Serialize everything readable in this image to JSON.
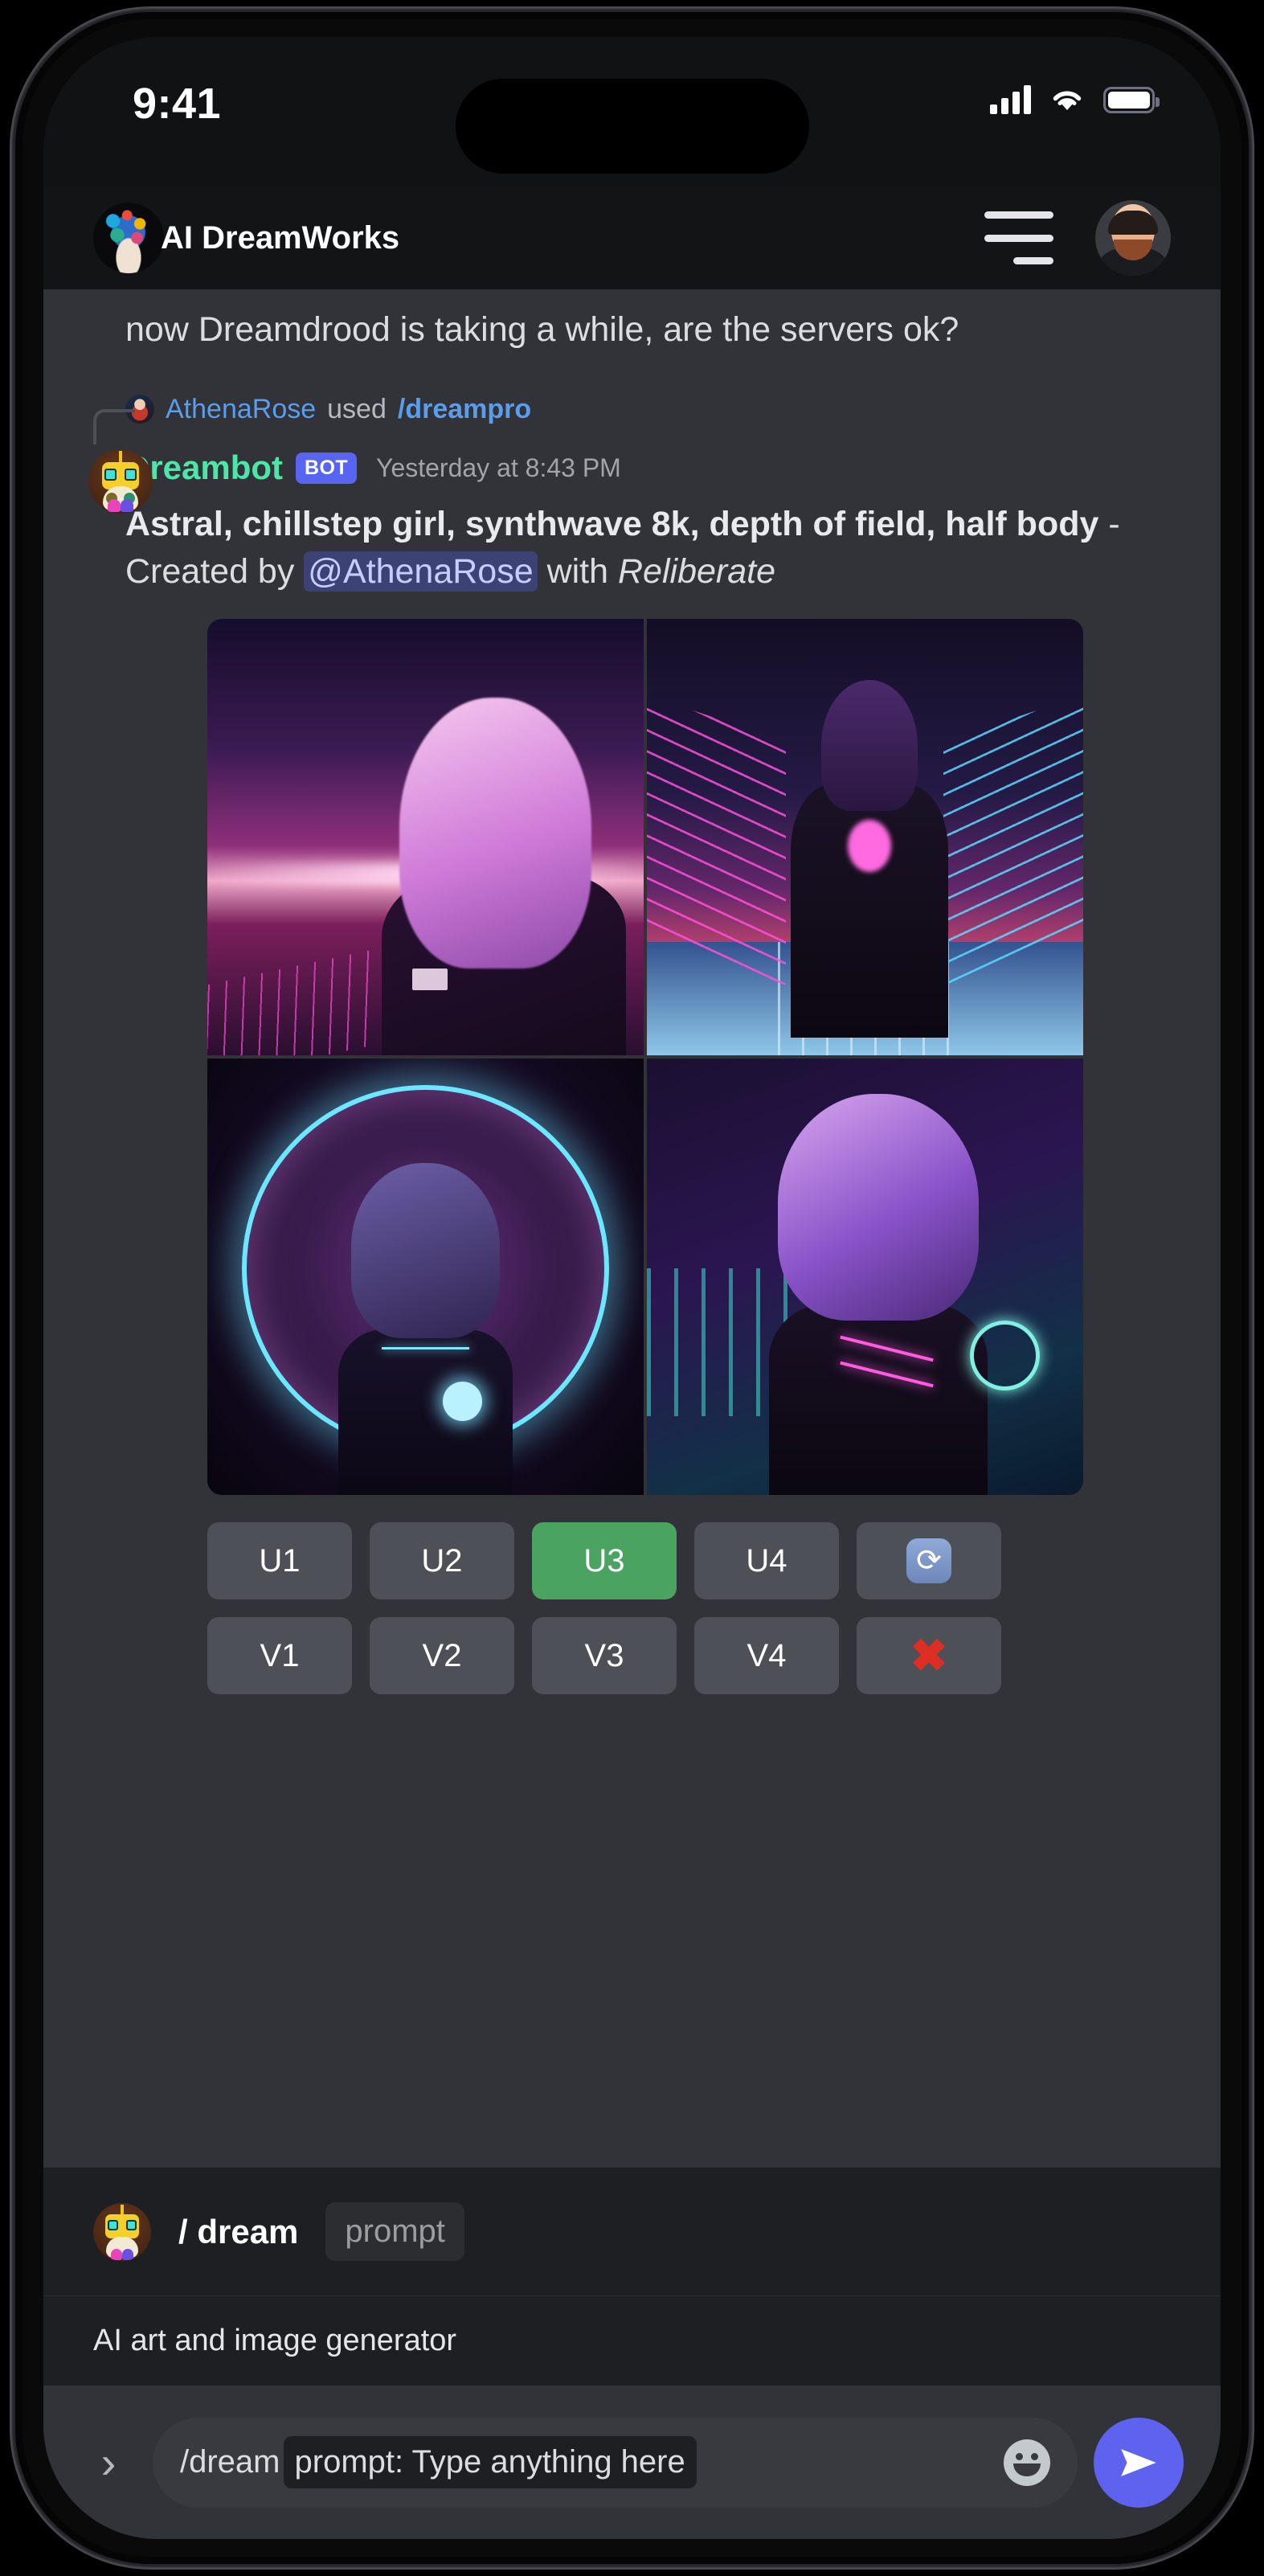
{
  "status_bar": {
    "time": "9:41",
    "cellular_icon": "signal-bars-icon",
    "wifi_icon": "wifi-icon",
    "battery_icon": "battery-full-icon"
  },
  "header": {
    "title": "AI DreamWorks",
    "logo_icon": "app-logo-icon",
    "menu_icon": "hamburger-menu-icon",
    "avatar_icon": "user-avatar-icon"
  },
  "chat": {
    "previous_message": "now Dreamdrood is taking a while, are the servers ok?",
    "reply_reference": {
      "username": "AthenaRose",
      "used_text": "used",
      "command": "/dreampro"
    },
    "bot": {
      "name": "Dreambot",
      "badge": "BOT",
      "timestamp": "Yesterday at 8:43 PM",
      "prompt": "Astral, chillstep girl, synthwave 8k, depth of field, half body",
      "separator": "-",
      "created_by_label": "Created by",
      "mention": "@AthenaRose",
      "with_label": "with",
      "model": "Reliberate"
    },
    "image_grid": {
      "images": [
        {
          "alt": "astral chillstep girl pink hair synthwave sunset"
        },
        {
          "alt": "girl in dark suit neon corridor"
        },
        {
          "alt": "girl with planet ring glow portrait"
        },
        {
          "alt": "purple bob hair neon bodysuit"
        }
      ]
    },
    "actions": {
      "row1": [
        {
          "label": "U1",
          "style": "default",
          "icon": ""
        },
        {
          "label": "U2",
          "style": "default",
          "icon": ""
        },
        {
          "label": "U3",
          "style": "green",
          "icon": ""
        },
        {
          "label": "U4",
          "style": "default",
          "icon": ""
        },
        {
          "label": "",
          "style": "default",
          "icon": "refresh-icon"
        }
      ],
      "row2": [
        {
          "label": "V1",
          "style": "default",
          "icon": ""
        },
        {
          "label": "V2",
          "style": "default",
          "icon": ""
        },
        {
          "label": "V3",
          "style": "default",
          "icon": ""
        },
        {
          "label": "V4",
          "style": "default",
          "icon": ""
        },
        {
          "label": "",
          "style": "default",
          "icon": "cancel-x-icon"
        }
      ]
    }
  },
  "command_suggestion": {
    "avatar_icon": "dreambot-avatar-icon",
    "name": "/ dream",
    "argument": "prompt",
    "description": "AI art and image generator"
  },
  "composer": {
    "expand_icon": "chevron-right-icon",
    "command_text": "/dream",
    "chip_text": "prompt: Type anything here",
    "emoji_icon": "emoji-smiley-icon",
    "send_icon": "send-paper-plane-icon"
  },
  "colors": {
    "accent_blurple": "#5865F2",
    "bot_name_green": "#4EE6A8",
    "link_blue": "#5A9DEA",
    "success_green": "#4AA361",
    "danger_red": "#DD2E23",
    "chat_bg": "#313338",
    "panel_bg": "#1E1F22"
  }
}
